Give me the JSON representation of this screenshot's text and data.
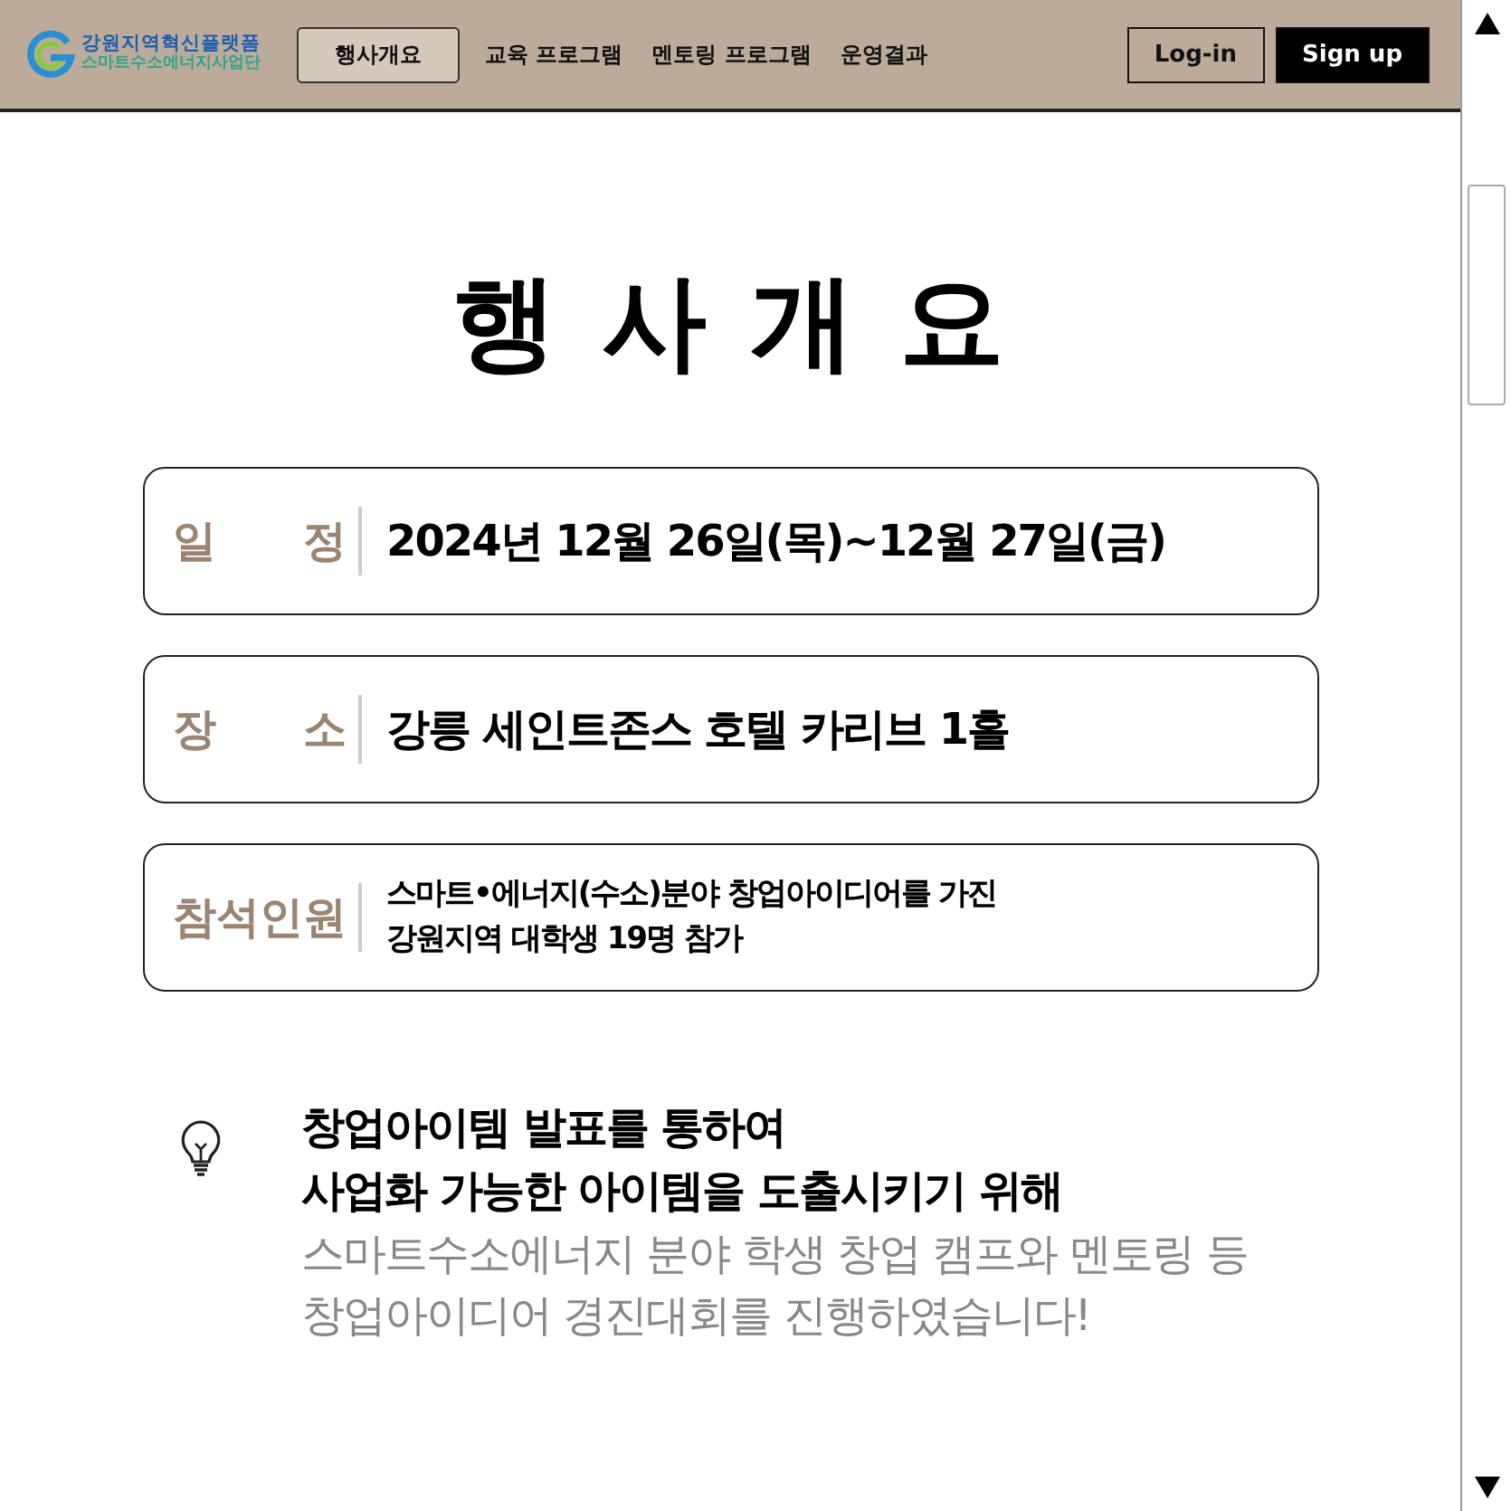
{
  "header": {
    "logo": {
      "line1": "강원지역혁신플랫폼",
      "line2": "스마트수소에너지사업단"
    },
    "nav": [
      {
        "label": "행사개요",
        "selected": true
      },
      {
        "label": "교육 프로그램",
        "selected": false
      },
      {
        "label": "멘토링 프로그램",
        "selected": false
      },
      {
        "label": "운영결과",
        "selected": false
      }
    ],
    "login": "Log-in",
    "signup": "Sign up"
  },
  "title": "행 사 개 요",
  "info": [
    {
      "label": "일 정",
      "lines": [
        "2024년 12월 26일(목)~12월 27일(금)"
      ]
    },
    {
      "label": "장 소",
      "lines": [
        "강릉 세인트존스 호텔 카리브 1홀"
      ]
    },
    {
      "label": "참석인원",
      "lines": [
        "스마트•에너지(수소)분야 창업아이디어를 가진",
        "강원지역 대학생 19명 참가"
      ]
    }
  ],
  "purpose": {
    "headline": [
      "창업아이템 발표를 통하여",
      "사업화 가능한 아이템을 도출시키기 위해"
    ],
    "body": [
      "스마트수소에너지 분야 학생 창업 캠프와 멘토링 등",
      "창업아이디어 경진대회를 진행하였습니다!"
    ]
  }
}
